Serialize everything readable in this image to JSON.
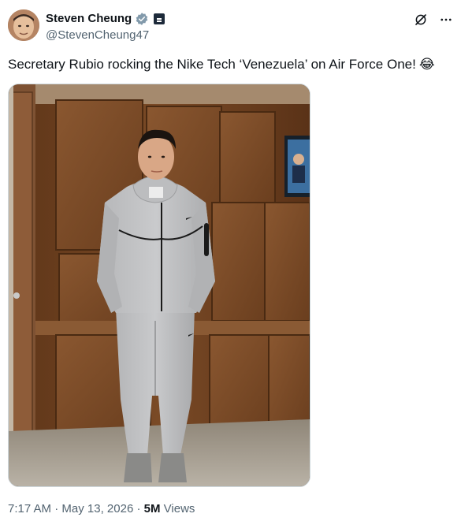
{
  "author": {
    "display_name": "Steven Cheung",
    "handle": "@StevenCheung47",
    "verified": true,
    "affiliate_badge": "government-badge-icon"
  },
  "tweet": {
    "text": "Secretary Rubio rocking the Nike Tech ‘Venezuela’ on Air Force One!",
    "emoji": "😂"
  },
  "meta": {
    "time": "7:17 AM",
    "separator": "·",
    "date": "May 13, 2026",
    "views_count": "5M",
    "views_label": "Views"
  },
  "icons": {
    "grok": "grok-icon",
    "more": "more-options-icon"
  },
  "colors": {
    "text": "#0f1419",
    "secondary": "#536471",
    "verified": "#829aab",
    "border": "#cfd9de"
  }
}
